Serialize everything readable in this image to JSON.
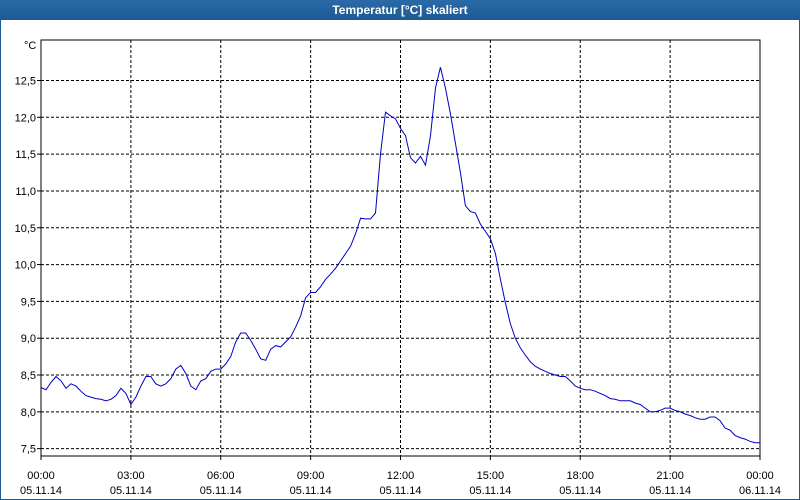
{
  "window": {
    "title": "Temperatur [°C] skaliert"
  },
  "colors": {
    "title_bg": "#1c5a94",
    "series": "#0000c0",
    "grid": "#000000"
  },
  "chart_data": {
    "type": "line",
    "title": "Temperatur [°C] skaliert",
    "ylabel": "°C",
    "xlabel": "",
    "ylim": [
      7.4,
      13.05
    ],
    "xlim": [
      "05.11.14 00:00",
      "06.11.14 00:00"
    ],
    "grid": true,
    "y_ticks": [
      "7,5",
      "8,0",
      "8,5",
      "9,0",
      "9,5",
      "10,0",
      "10,5",
      "11,0",
      "11,5",
      "12,0",
      "12,5"
    ],
    "y_tick_values": [
      7.5,
      8.0,
      8.5,
      9.0,
      9.5,
      10.0,
      10.5,
      11.0,
      11.5,
      12.0,
      12.5
    ],
    "x_ticks": [
      {
        "time": "00:00",
        "date": "05.11.14"
      },
      {
        "time": "03:00",
        "date": "05.11.14"
      },
      {
        "time": "06:00",
        "date": "05.11.14"
      },
      {
        "time": "09:00",
        "date": "05.11.14"
      },
      {
        "time": "12:00",
        "date": "05.11.14"
      },
      {
        "time": "15:00",
        "date": "05.11.14"
      },
      {
        "time": "18:00",
        "date": "05.11.14"
      },
      {
        "time": "21:00",
        "date": "05.11.14"
      },
      {
        "time": "00:00",
        "date": "06.11.14"
      }
    ],
    "series": [
      {
        "x": [
          "00:00",
          "00:10",
          "00:20",
          "00:30",
          "00:40",
          "00:50",
          "01:00",
          "01:10",
          "01:20",
          "01:30",
          "01:40",
          "01:50",
          "02:00",
          "02:10",
          "02:20",
          "02:30",
          "02:40",
          "02:50",
          "03:00",
          "03:10",
          "03:20",
          "03:30",
          "03:40",
          "03:50",
          "04:00",
          "04:10",
          "04:20",
          "04:30",
          "04:40",
          "04:50",
          "05:00",
          "05:10",
          "05:20",
          "05:30",
          "05:40",
          "05:50",
          "06:00",
          "06:10",
          "06:20",
          "06:30",
          "06:40",
          "06:50",
          "07:00",
          "07:10",
          "07:20",
          "07:30",
          "07:40",
          "07:50",
          "08:00",
          "08:10",
          "08:20",
          "08:30",
          "08:40",
          "08:50",
          "09:00",
          "09:10",
          "09:20",
          "09:30",
          "09:40",
          "09:50",
          "10:00",
          "10:10",
          "10:20",
          "10:30",
          "10:40",
          "10:50",
          "11:00",
          "11:10",
          "11:20",
          "11:30",
          "11:40",
          "11:50",
          "12:00",
          "12:10",
          "12:20",
          "12:30",
          "12:40",
          "12:50",
          "13:00",
          "13:10",
          "13:20",
          "13:30",
          "13:40",
          "13:50",
          "14:00",
          "14:10",
          "14:20",
          "14:30",
          "14:40",
          "14:50",
          "15:00",
          "15:10",
          "15:20",
          "15:30",
          "15:40",
          "15:50",
          "16:00",
          "16:10",
          "16:20",
          "16:30",
          "16:40",
          "16:50",
          "17:00",
          "17:10",
          "17:20",
          "17:30",
          "17:40",
          "17:50",
          "18:00",
          "18:10",
          "18:20",
          "18:30",
          "18:40",
          "18:50",
          "19:00",
          "19:10",
          "19:20",
          "19:30",
          "19:40",
          "19:50",
          "20:00",
          "20:10",
          "20:20",
          "20:30",
          "20:40",
          "20:50",
          "21:00",
          "21:10",
          "21:20",
          "21:30",
          "21:40",
          "21:50",
          "22:00",
          "22:10",
          "22:20",
          "22:30",
          "22:40",
          "22:50",
          "23:00",
          "23:10",
          "23:20",
          "23:30",
          "23:40",
          "23:50",
          "00:00"
        ],
        "values": [
          8.33,
          8.3,
          8.4,
          8.48,
          8.42,
          8.32,
          8.38,
          8.35,
          8.28,
          8.22,
          8.2,
          8.18,
          8.17,
          8.15,
          8.17,
          8.22,
          8.32,
          8.25,
          8.1,
          8.2,
          8.35,
          8.48,
          8.48,
          8.38,
          8.35,
          8.38,
          8.45,
          8.58,
          8.63,
          8.52,
          8.35,
          8.3,
          8.42,
          8.45,
          8.55,
          8.58,
          8.58,
          8.65,
          8.75,
          8.95,
          9.07,
          9.07,
          8.97,
          8.85,
          8.72,
          8.7,
          8.85,
          8.9,
          8.88,
          8.95,
          9.02,
          9.15,
          9.3,
          9.55,
          9.62,
          9.62,
          9.7,
          9.8,
          9.87,
          9.95,
          10.05,
          10.15,
          10.25,
          10.42,
          10.63,
          10.62,
          10.62,
          10.7,
          11.5,
          12.07,
          12.02,
          11.98,
          11.85,
          11.75,
          11.45,
          11.38,
          11.47,
          11.35,
          11.75,
          12.4,
          12.68,
          12.4,
          12.05,
          11.65,
          11.25,
          10.8,
          10.72,
          10.7,
          10.55,
          10.45,
          10.35,
          10.15,
          9.8,
          9.48,
          9.2,
          9.0,
          8.87,
          8.77,
          8.68,
          8.62,
          8.58,
          8.55,
          8.52,
          8.5,
          8.48,
          8.48,
          8.42,
          8.35,
          8.32,
          8.3,
          8.3,
          8.28,
          8.25,
          8.22,
          8.18,
          8.17,
          8.15,
          8.15,
          8.15,
          8.12,
          8.1,
          8.05,
          8.0,
          8.0,
          8.02,
          8.05,
          8.05,
          8.02,
          8.0,
          7.97,
          7.95,
          7.92,
          7.9,
          7.9,
          7.93,
          7.93,
          7.88,
          7.78,
          7.75,
          7.68,
          7.65,
          7.63,
          7.6,
          7.58,
          7.58
        ]
      }
    ]
  }
}
